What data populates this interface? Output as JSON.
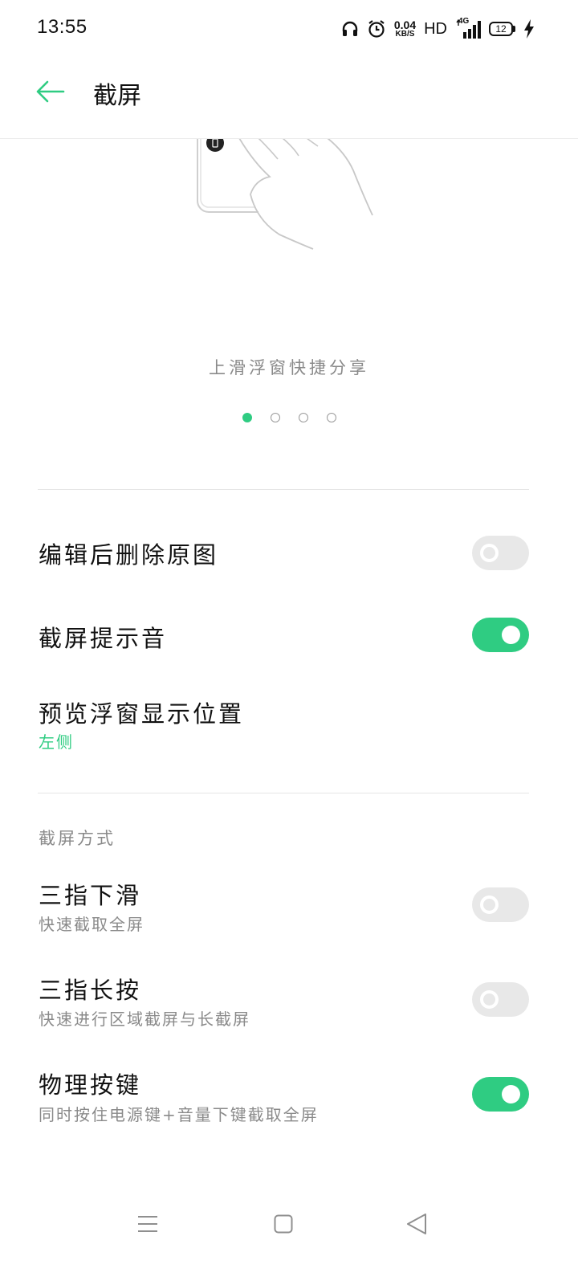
{
  "status_bar": {
    "time": "13:55",
    "net_speed_value": "0.04",
    "net_speed_unit": "KB/S",
    "hd_label": "HD",
    "network_type": "4G",
    "battery_level": "12",
    "icons": [
      "headphones-icon",
      "alarm-icon",
      "signal-icon",
      "battery-icon",
      "charging-icon"
    ]
  },
  "header": {
    "title": "截屏",
    "back_icon": "arrow-left-icon"
  },
  "carousel": {
    "caption": "上滑浮窗快捷分享",
    "page_count": 4,
    "active_page": 1
  },
  "settings": {
    "delete_original": {
      "title": "编辑后删除原图",
      "enabled": false
    },
    "shutter_sound": {
      "title": "截屏提示音",
      "enabled": true
    },
    "preview_position": {
      "title": "预览浮窗显示位置",
      "value": "左侧"
    }
  },
  "methods": {
    "section_title": "截屏方式",
    "three_finger_swipe": {
      "title": "三指下滑",
      "subtitle": "快速截取全屏",
      "enabled": false
    },
    "three_finger_hold": {
      "title": "三指长按",
      "subtitle": "快速进行区域截屏与长截屏",
      "enabled": false
    },
    "physical_keys": {
      "title": "物理按键",
      "subtitle": "同时按住电源键+音量下键截取全屏",
      "enabled": true
    }
  },
  "nav_bar": {
    "icons": [
      "menu-icon",
      "home-icon",
      "back-icon"
    ]
  },
  "colors": {
    "accent": "#2fcc82",
    "switch_off": "#e8e8e8",
    "secondary_text": "#8a8a8a"
  }
}
